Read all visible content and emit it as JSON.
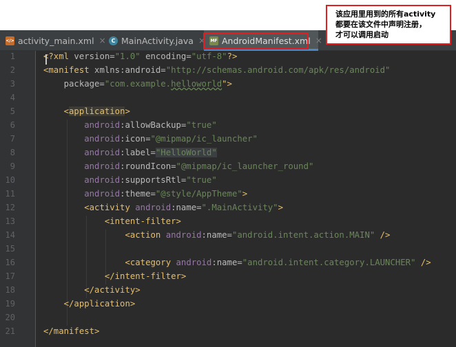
{
  "annotation": {
    "lines": [
      "该应用里用到的所有activity",
      "都要在该文件中声明注册，",
      "才可以调用启动"
    ]
  },
  "tabs": [
    {
      "label": "activity_main.xml",
      "icon": "xml-file-icon",
      "active": false
    },
    {
      "label": "MainActivity.java",
      "icon": "java-class-icon",
      "active": false
    },
    {
      "label": "AndroidManifest.xml",
      "icon": "manifest-file-icon",
      "active": true
    }
  ],
  "tab_close_symbol": "×",
  "colors": {
    "tag": "#e8bf6a",
    "attribute": "#bababa",
    "namespace": "#9876aa",
    "string": "#6a8759",
    "text": "#a9b7c6",
    "highlight_border": "#e02020"
  },
  "code_lines": [
    {
      "n": "1",
      "tokens": [
        [
          "<?xml ",
          "tag"
        ],
        [
          "version=",
          "attr"
        ],
        [
          "\"1.0\"",
          "val"
        ],
        [
          " encoding=",
          "attr"
        ],
        [
          "\"utf-8\"",
          "val"
        ],
        [
          "?>",
          "tag"
        ]
      ]
    },
    {
      "n": "2",
      "tokens": [
        [
          "<manifest ",
          "tag"
        ],
        [
          "xmlns:",
          "attr"
        ],
        [
          "android",
          "attr"
        ],
        [
          "=",
          "attr"
        ],
        [
          "\"http://schemas.android.com/apk/res/android\"",
          "val"
        ]
      ]
    },
    {
      "n": "3",
      "tokens": [
        [
          "    package=",
          "attr"
        ],
        [
          "\"com.example.",
          "val"
        ],
        [
          "helloworld",
          "val"
        ],
        [
          "\">",
          "tag"
        ]
      ]
    },
    {
      "n": "4",
      "tokens": []
    },
    {
      "n": "5",
      "tokens": [
        [
          "    ",
          "plain"
        ],
        [
          "<",
          "tag"
        ],
        [
          "application",
          "tag"
        ],
        [
          ">",
          "tag"
        ]
      ]
    },
    {
      "n": "6",
      "tokens": [
        [
          "        ",
          "plain"
        ],
        [
          "android",
          "ns"
        ],
        [
          ":allowBackup=",
          "attr"
        ],
        [
          "\"true\"",
          "val"
        ]
      ]
    },
    {
      "n": "7",
      "tokens": [
        [
          "        ",
          "plain"
        ],
        [
          "android",
          "ns"
        ],
        [
          ":icon=",
          "attr"
        ],
        [
          "\"@mipmap/ic_launcher\"",
          "val"
        ]
      ]
    },
    {
      "n": "8",
      "tokens": [
        [
          "        ",
          "plain"
        ],
        [
          "android",
          "ns"
        ],
        [
          ":label=",
          "attr"
        ],
        [
          "\"HelloWorld\"",
          "val"
        ]
      ]
    },
    {
      "n": "9",
      "tokens": [
        [
          "        ",
          "plain"
        ],
        [
          "android",
          "ns"
        ],
        [
          ":roundIcon=",
          "attr"
        ],
        [
          "\"@mipmap/ic_launcher_round\"",
          "val"
        ]
      ]
    },
    {
      "n": "10",
      "tokens": [
        [
          "        ",
          "plain"
        ],
        [
          "android",
          "ns"
        ],
        [
          ":supportsRtl=",
          "attr"
        ],
        [
          "\"true\"",
          "val"
        ]
      ]
    },
    {
      "n": "11",
      "tokens": [
        [
          "        ",
          "plain"
        ],
        [
          "android",
          "ns"
        ],
        [
          ":theme=",
          "attr"
        ],
        [
          "\"@style/AppTheme\"",
          "val"
        ],
        [
          ">",
          "tag"
        ]
      ]
    },
    {
      "n": "12",
      "tokens": [
        [
          "        ",
          "plain"
        ],
        [
          "<activity ",
          "tag"
        ],
        [
          "android",
          "ns"
        ],
        [
          ":name=",
          "attr"
        ],
        [
          "\".MainActivity\"",
          "val"
        ],
        [
          ">",
          "tag"
        ]
      ]
    },
    {
      "n": "13",
      "tokens": [
        [
          "            ",
          "plain"
        ],
        [
          "<intent-filter>",
          "tag"
        ]
      ]
    },
    {
      "n": "14",
      "tokens": [
        [
          "                ",
          "plain"
        ],
        [
          "<action ",
          "tag"
        ],
        [
          "android",
          "ns"
        ],
        [
          ":name=",
          "attr"
        ],
        [
          "\"android.intent.action.MAIN\"",
          "val"
        ],
        [
          " />",
          "tag"
        ]
      ]
    },
    {
      "n": "15",
      "tokens": []
    },
    {
      "n": "16",
      "tokens": [
        [
          "                ",
          "plain"
        ],
        [
          "<category ",
          "tag"
        ],
        [
          "android",
          "ns"
        ],
        [
          ":name=",
          "attr"
        ],
        [
          "\"android.intent.category.LAUNCHER\"",
          "val"
        ],
        [
          " />",
          "tag"
        ]
      ]
    },
    {
      "n": "17",
      "tokens": [
        [
          "            ",
          "plain"
        ],
        [
          "</intent-filter>",
          "tag"
        ]
      ]
    },
    {
      "n": "18",
      "tokens": [
        [
          "        ",
          "plain"
        ],
        [
          "</activity>",
          "tag"
        ]
      ]
    },
    {
      "n": "19",
      "tokens": [
        [
          "    ",
          "plain"
        ],
        [
          "</application>",
          "tag"
        ]
      ]
    },
    {
      "n": "20",
      "tokens": []
    },
    {
      "n": "21",
      "tokens": [
        [
          "</manifest>",
          "tag"
        ]
      ]
    }
  ]
}
